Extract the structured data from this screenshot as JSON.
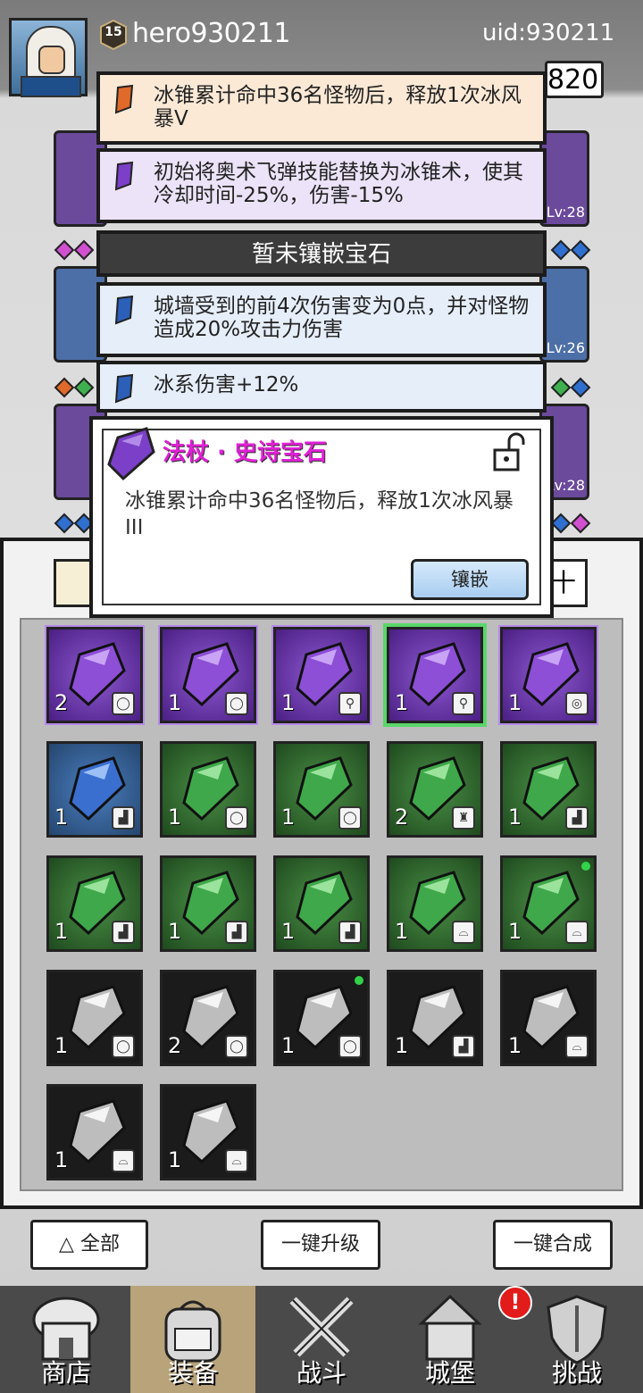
{
  "header": {
    "level": "15",
    "username": "hero930211",
    "uid": "uid:930211",
    "currency_partial": "820"
  },
  "equipment_levels": [
    "Lv:28",
    "Lv:26",
    "Lv:28"
  ],
  "tooltips": [
    {
      "gem_color": "#e06a2a",
      "bg": "#fbe9d6",
      "text": "冰锥累计命中36名怪物后，释放1次冰风暴V"
    },
    {
      "gem_color": "#7b3fc8",
      "bg": "#ece3f8",
      "text": "初始将奥术飞弹技能替换为冰锥术，使其冷却时间-25%，伤害-15%"
    },
    {
      "empty": true,
      "text": "暂未镶嵌宝石"
    },
    {
      "gem_color": "#2b5fb8",
      "bg": "#e6eefa",
      "text": "城墙受到的前4次伤害变为0点，并对怪物造成20%攻击力伤害"
    },
    {
      "gem_color": "#2b5fb8",
      "bg": "#e6eefa",
      "text": "冰系伤害+12%"
    }
  ],
  "popup": {
    "title": "法杖 · 史诗宝石",
    "description": "冰锥累计命中36名怪物后，释放1次冰风暴III",
    "inlay_button": "镶嵌",
    "lock_icon": "unlocked-padlock-icon"
  },
  "inventory": {
    "partial_tab_glyph": "十",
    "rows": [
      [
        {
          "color": "purple",
          "count": "2",
          "slot": "ring",
          "selected": false,
          "dot": false
        },
        {
          "color": "purple",
          "count": "1",
          "slot": "ring",
          "selected": false,
          "dot": false
        },
        {
          "color": "purple",
          "count": "1",
          "slot": "staff",
          "selected": false,
          "dot": false
        },
        {
          "color": "purple",
          "count": "1",
          "slot": "staff",
          "selected": true,
          "dot": false
        },
        {
          "color": "purple",
          "count": "1",
          "slot": "necklace",
          "selected": false,
          "dot": false
        }
      ],
      [
        {
          "color": "blue",
          "count": "1",
          "slot": "boots",
          "selected": false,
          "dot": false
        },
        {
          "color": "green",
          "count": "1",
          "slot": "ring",
          "selected": false,
          "dot": false
        },
        {
          "color": "green",
          "count": "1",
          "slot": "ring",
          "selected": false,
          "dot": false
        },
        {
          "color": "green",
          "count": "2",
          "slot": "armor",
          "selected": false,
          "dot": false
        },
        {
          "color": "green",
          "count": "1",
          "slot": "boots",
          "selected": false,
          "dot": false
        }
      ],
      [
        {
          "color": "green",
          "count": "1",
          "slot": "boots",
          "selected": false,
          "dot": false
        },
        {
          "color": "green",
          "count": "1",
          "slot": "boots",
          "selected": false,
          "dot": false
        },
        {
          "color": "green",
          "count": "1",
          "slot": "boots",
          "selected": false,
          "dot": false
        },
        {
          "color": "green",
          "count": "1",
          "slot": "hat",
          "selected": false,
          "dot": false
        },
        {
          "color": "green",
          "count": "1",
          "slot": "hat",
          "selected": false,
          "dot": true
        }
      ],
      [
        {
          "color": "gray",
          "count": "1",
          "slot": "ring",
          "selected": false,
          "dot": false
        },
        {
          "color": "gray",
          "count": "2",
          "slot": "ring",
          "selected": false,
          "dot": false
        },
        {
          "color": "gray",
          "count": "1",
          "slot": "ring",
          "selected": false,
          "dot": true
        },
        {
          "color": "gray",
          "count": "1",
          "slot": "boots",
          "selected": false,
          "dot": false
        },
        {
          "color": "gray",
          "count": "1",
          "slot": "hat",
          "selected": false,
          "dot": false
        }
      ],
      [
        {
          "color": "gray",
          "count": "1",
          "slot": "hat",
          "selected": false,
          "dot": false
        },
        {
          "color": "gray",
          "count": "1",
          "slot": "hat",
          "selected": false,
          "dot": false
        }
      ]
    ]
  },
  "actions": {
    "filter_all": "全部",
    "upgrade_all": "一键升级",
    "merge_all": "一键合成"
  },
  "nav": [
    {
      "label": "商店",
      "icon": "shop-icon",
      "active": false
    },
    {
      "label": "装备",
      "icon": "backpack-icon",
      "active": true
    },
    {
      "label": "战斗",
      "icon": "crossed-swords-icon",
      "active": false
    },
    {
      "label": "城堡",
      "icon": "castle-icon",
      "active": false
    },
    {
      "label": "挑战",
      "icon": "shield-icon",
      "active": false
    }
  ],
  "notice_badge": "!"
}
